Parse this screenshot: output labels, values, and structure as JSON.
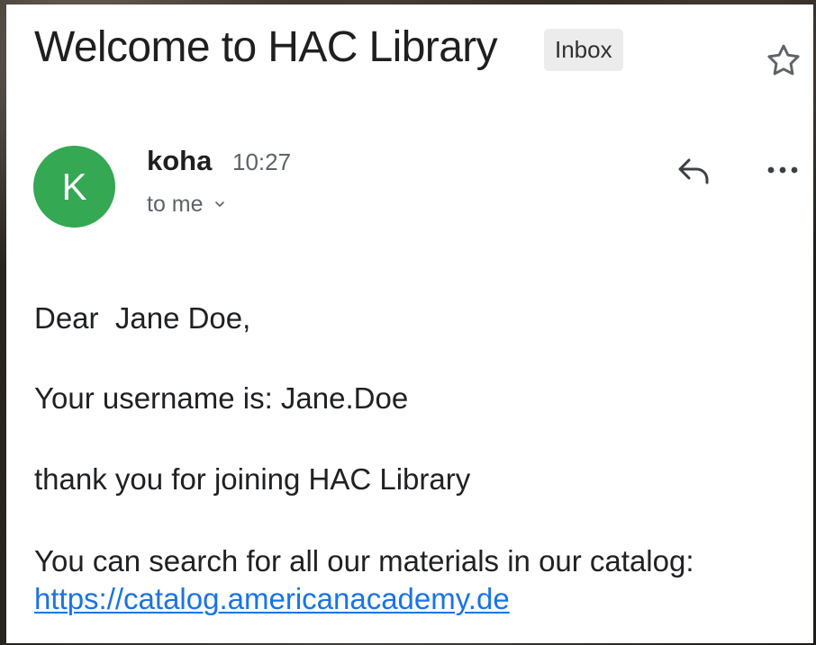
{
  "email": {
    "subject": "Welcome to HAC Library",
    "folder_label": "Inbox",
    "sender": {
      "avatar_initial": "K",
      "name": "koha",
      "time": "10:27",
      "recipient": "to me"
    },
    "body": {
      "greeting": "Dear  Jane Doe,",
      "username_line": "Your username is: Jane.Doe",
      "thanks_line": "thank you for joining HAC Library",
      "catalog_line": "You can search for all our materials in our catalog:",
      "catalog_url": "https://catalog.americanacademy.de"
    }
  },
  "icons": {
    "star": "star-outline-icon",
    "reply": "reply-icon",
    "more": "more-horizontal-icon",
    "recipient_toggle": "chevron-down-icon"
  },
  "colors": {
    "avatar": "#34a853",
    "link": "#1a73e8",
    "inbox_chip": "#ececec"
  }
}
